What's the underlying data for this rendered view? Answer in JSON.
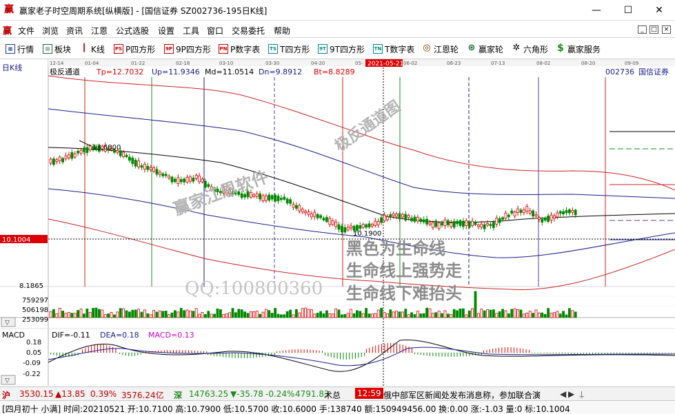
{
  "window": {
    "title": "赢家老子时空周期系统[纵横版] - [国信证券  SZ002736-195日K线]",
    "minimize": "—",
    "maximize": "☐",
    "close": "✕"
  },
  "menu": {
    "logo": "赢",
    "items": [
      "文件",
      "浏览",
      "资讯",
      "江恩",
      "公式选股",
      "设置",
      "工具",
      "窗口",
      "交易委托",
      "帮助"
    ],
    "mdi": [
      "_",
      "□",
      "×"
    ]
  },
  "toolbar": {
    "items": [
      {
        "label": "行情",
        "icon": "grid-icon"
      },
      {
        "label": "板块",
        "icon": "board-icon"
      },
      {
        "label": "K线",
        "icon": "candle-icon"
      },
      {
        "label": "P四方形",
        "icon": "ps-icon",
        "glyph": "PS"
      },
      {
        "label": "9P四方形",
        "icon": "9p-icon",
        "glyph": "9P"
      },
      {
        "label": "P数字表",
        "icon": "pn-icon",
        "glyph": "PN"
      },
      {
        "label": "T四方形",
        "icon": "ts-icon",
        "glyph": "TS"
      },
      {
        "label": "9T四方形",
        "icon": "9t-icon",
        "glyph": "9T"
      },
      {
        "label": "T数字表",
        "icon": "tn-icon",
        "glyph": "TN"
      },
      {
        "label": "江恩轮",
        "icon": "gann-wheel-icon",
        "glyph": "◎"
      },
      {
        "label": "赢家轮",
        "icon": "winner-wheel-icon",
        "glyph": "⊛"
      },
      {
        "label": "六角形",
        "icon": "hexagon-icon",
        "glyph": "✲"
      },
      {
        "label": "赢家服务",
        "icon": "service-icon",
        "glyph": "$"
      }
    ]
  },
  "chart": {
    "period_label": "日K线",
    "indicator_name": "极反通道",
    "tp": "Tp=12.7032",
    "up": "Up=11.9346",
    "md": "Md=11.0514",
    "dn": "Dn=9.8912",
    "bt": "Bt=8.8289",
    "stock_code": "002736",
    "stock_name": "国信证券",
    "date_ticks": [
      "12-14",
      "01-04",
      "01-22",
      "02-18",
      "03-10",
      "03-30",
      "04-20",
      "05-",
      "06-02",
      "06-23",
      "07-13",
      "08-02",
      "08-20",
      "09-09"
    ],
    "cursor_date": "2021-05-21",
    "cursor_price": "10.1004",
    "price_low_axis": "8.1865",
    "high_mark": "13.6800",
    "low_mark": "10.1900",
    "volume_ticks": [
      "759297",
      "506198",
      "253099"
    ],
    "colors": {
      "up": "#dd0000",
      "down": "#008800",
      "cursor": "#dd0000",
      "ma": "#000000",
      "band_mid": "#1a1a8c",
      "band_outer": "#cc2222"
    }
  },
  "macd": {
    "label": "MACD",
    "dif": "DIF=-0.11",
    "dea": "DEA=0.18",
    "macd": "MACD=0.13",
    "ticks": [
      "0.18",
      "0.05",
      "-0.09",
      "-0.22"
    ],
    "colors": {
      "dif": "#000000",
      "dea": "#1a1a8c",
      "macd": "#cc00cc"
    }
  },
  "watermarks": {
    "product": "赢家江恩软件",
    "chart_name": "极反通道图",
    "qq": "QQ:100800360",
    "line1": "黑色为生命线",
    "line2": "生命线上强势走",
    "line3": "生命线下难抬头"
  },
  "status": {
    "sh_index": "3530.15",
    "sh_change": "▲13.85",
    "sh_pct": "0.39%",
    "sh_amount": "3576.24亿",
    "sz_index": "14763.25",
    "sz_change": "▼-35.78",
    "sz_pct": "-0.24%",
    "sz_amount": "4791.83",
    "tech": "术总",
    "time": "12:59",
    "news": "俄中部军区新闻处发布消息称，参加联合演"
  },
  "bar": {
    "info": "[四月初十 小满] 时间:20210521 开:10.7100 高:10.7900 低:10.5700 收:10.6000 手:138740 额:150949456.00 换:0.00 涨:-1.03 量:0 标:10.1004"
  }
}
